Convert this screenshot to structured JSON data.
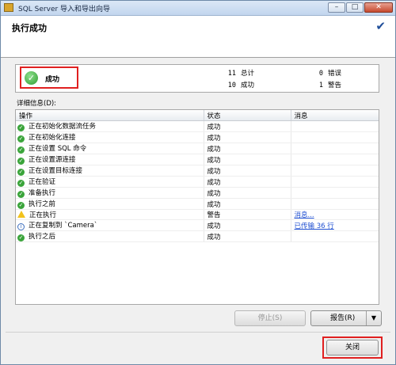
{
  "window": {
    "title": "SQL Server 导入和导出向导"
  },
  "header": {
    "title": "执行成功"
  },
  "summary": {
    "status_label": "成功",
    "total_count": "11",
    "total_label": "总计",
    "success_count": "10",
    "success_label": "成功",
    "error_count": "0",
    "error_label": "错误",
    "warning_count": "1",
    "warning_label": "警告"
  },
  "details": {
    "label": "详细信息(D):",
    "columns": [
      "操作",
      "状态",
      "消息"
    ],
    "rows": [
      {
        "icon": "success-icon",
        "action": "正在初始化数据流任务",
        "status": "成功",
        "message": ""
      },
      {
        "icon": "success-icon",
        "action": "正在初始化连接",
        "status": "成功",
        "message": ""
      },
      {
        "icon": "success-icon",
        "action": "正在设置 SQL 命令",
        "status": "成功",
        "message": ""
      },
      {
        "icon": "success-icon",
        "action": "正在设置源连接",
        "status": "成功",
        "message": ""
      },
      {
        "icon": "success-icon",
        "action": "正在设置目标连接",
        "status": "成功",
        "message": ""
      },
      {
        "icon": "success-icon",
        "action": "正在验证",
        "status": "成功",
        "message": ""
      },
      {
        "icon": "success-icon",
        "action": "准备执行",
        "status": "成功",
        "message": ""
      },
      {
        "icon": "success-icon",
        "action": "执行之前",
        "status": "成功",
        "message": ""
      },
      {
        "icon": "warning-icon",
        "action": "正在执行",
        "status": "警告",
        "message": "消息..."
      },
      {
        "icon": "info-icon",
        "action": "正在复制到 `Camera`",
        "status": "成功",
        "message": "已传输 36 行"
      },
      {
        "icon": "success-icon",
        "action": "执行之后",
        "status": "成功",
        "message": ""
      }
    ]
  },
  "buttons": {
    "stop": "停止(S)",
    "report": "报告(R)",
    "close": "关闭"
  },
  "colors": {
    "highlight": "#e02020",
    "success": "#3aa43a",
    "link": "#1f4fd1"
  }
}
